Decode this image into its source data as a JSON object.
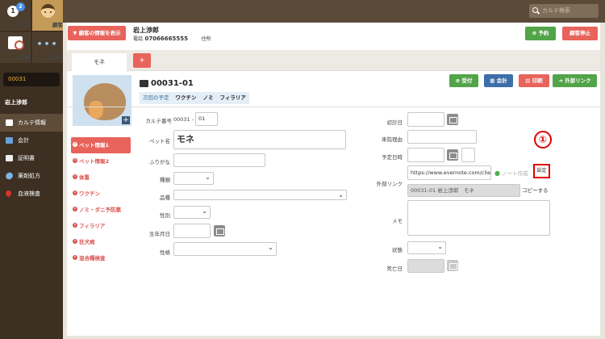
{
  "topbar": {
    "search_placeholder": "カルテ検索"
  },
  "sidebar": {
    "nav": [
      {
        "label": "受付",
        "badge": "2"
      },
      {
        "label": "顧客"
      },
      {
        "label": "検索"
      },
      {
        "label": "その他"
      }
    ],
    "customer_id": "00031",
    "customer_name": "岩上渉郎",
    "menu": [
      {
        "label": "カルテ情報"
      },
      {
        "label": "会計"
      },
      {
        "label": "証明書"
      },
      {
        "label": "薬剤処方"
      },
      {
        "label": "血液検査"
      }
    ]
  },
  "header": {
    "show_customer_button": "▼ 顧客の情報を表示",
    "customer_name": "岩上渉郎",
    "phone_label": "電話",
    "phone": "07066665555",
    "address_label": "住所",
    "reserve_button": "予約",
    "stop_button": "顧客停止"
  },
  "tabs": {
    "items": [
      "モネ"
    ],
    "add_label": "+"
  },
  "pet": {
    "id": "00031-01",
    "chips": [
      "次回の予定",
      "ワクチン",
      "ノミ",
      "フィラリア"
    ],
    "actions": [
      "受付",
      "会計",
      "印刷",
      "外部リンク"
    ]
  },
  "pet_menu": [
    "ペット情報1",
    "ペット情報2",
    "体重",
    "ワクチン",
    "ノミ・ダニ予防薬",
    "フィラリア",
    "狂犬病",
    "混合種検査"
  ],
  "form": {
    "karte_label": "カルテ番号",
    "karte_prefix": "00031 -",
    "karte_suffix": "01",
    "pet_name_label": "ペット名",
    "pet_name": "モネ",
    "furigana_label": "ふりがな",
    "species_label": "種類",
    "breed_label": "品種",
    "sex_label": "性別",
    "birthday_label": "生年月日",
    "temperament_label": "性格",
    "first_visit_label": "初診日",
    "reason_label": "来院理由",
    "scheduled_label": "予定日時",
    "ext_link_label": "外部リンク",
    "ext_link_url": "https://www.evernote.com/clie",
    "note_app": "ノート作成",
    "set_button": "設定",
    "link_text": "00031-01 岩上渉郎　モネ",
    "copy_button": "コピーする",
    "memo_label": "メモ",
    "status_label": "状態",
    "death_label": "死亡日"
  },
  "annotation": {
    "number": "①"
  }
}
